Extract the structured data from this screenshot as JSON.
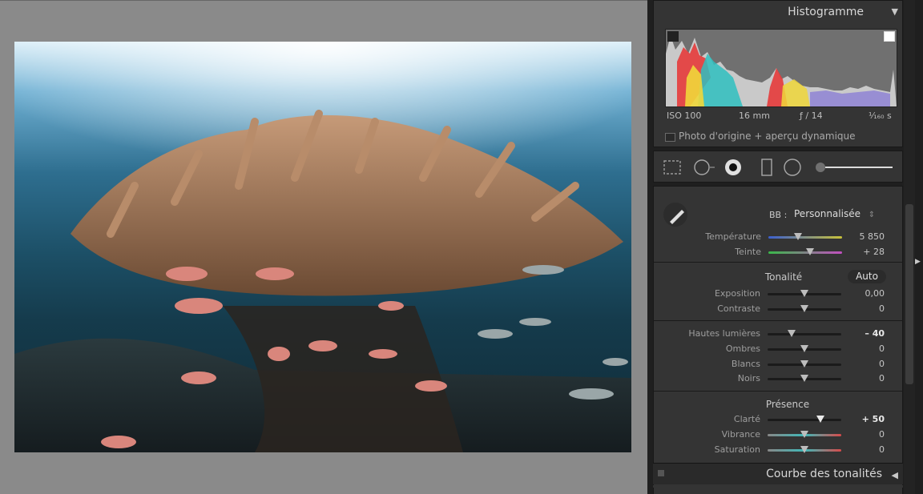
{
  "histogram": {
    "title": "Histogramme",
    "iso": "ISO 100",
    "focal": "16 mm",
    "aperture": "ƒ / 14",
    "shutter": "¹⁄₁₆₀ s",
    "preview_label": "Photo d'origine + aperçu dynamique"
  },
  "basic": {
    "wb_label": "BB :",
    "wb_value": "Personnalisée",
    "temperature": {
      "label": "Température",
      "value": "5 850",
      "level": 0.4
    },
    "tint": {
      "label": "Teinte",
      "value": "+ 28",
      "level": 0.57
    }
  },
  "tone": {
    "title": "Tonalité",
    "auto_label": "Auto",
    "exposure": {
      "label": "Exposition",
      "value": "0,00",
      "level": 0.5
    },
    "contrast": {
      "label": "Contraste",
      "value": "0",
      "level": 0.5
    },
    "highlights": {
      "label": "Hautes lumières",
      "value": "– 40",
      "level": 0.33
    },
    "shadows": {
      "label": "Ombres",
      "value": "0",
      "level": 0.5
    },
    "whites": {
      "label": "Blancs",
      "value": "0",
      "level": 0.5
    },
    "blacks": {
      "label": "Noirs",
      "value": "0",
      "level": 0.5
    }
  },
  "presence": {
    "title": "Présence",
    "clarity": {
      "label": "Clarté",
      "value": "+ 50",
      "level": 0.72
    },
    "vibrance": {
      "label": "Vibrance",
      "value": "0",
      "level": 0.5
    },
    "saturation": {
      "label": "Saturation",
      "value": "0",
      "level": 0.5
    }
  },
  "tone_curve": {
    "title": "Courbe des tonalités"
  },
  "colors": {
    "accent": "#d7d7d7",
    "panel": "#343434"
  }
}
